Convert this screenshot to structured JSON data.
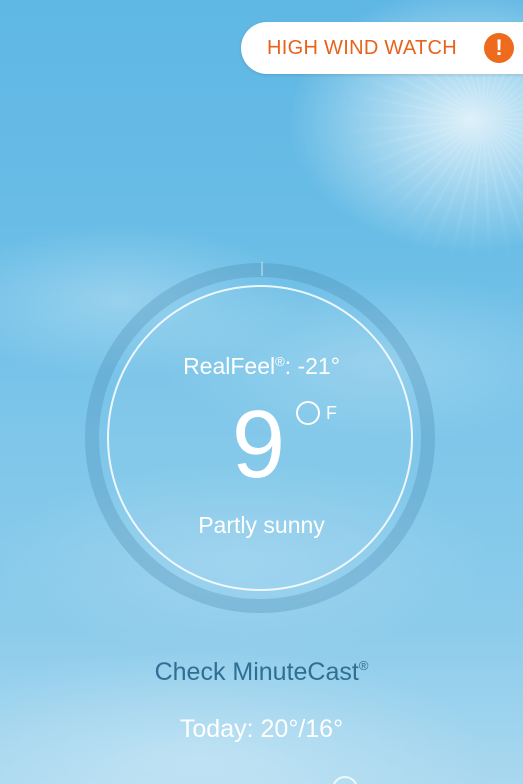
{
  "alert": {
    "label": "HIGH WIND WATCH",
    "icon": "exclamation-icon",
    "icon_glyph": "!",
    "color": "#e8621c"
  },
  "current": {
    "realfeel_label": "RealFeel",
    "realfeel_mark": "®",
    "realfeel_value": ": -21°",
    "temperature": "9",
    "unit": "F",
    "condition": "Partly sunny"
  },
  "minutecast": {
    "label": "Check MinuteCast",
    "mark": "®",
    "color": "#2e6f93"
  },
  "forecast": {
    "today": "Today: 20°/16°"
  }
}
